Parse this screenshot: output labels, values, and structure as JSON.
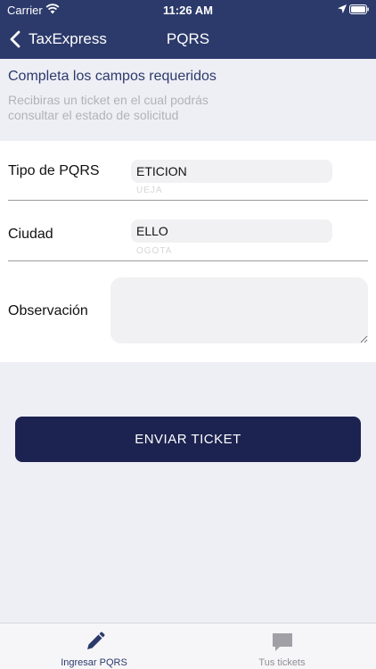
{
  "status_bar": {
    "carrier": "Carrier",
    "time": "11:26 AM"
  },
  "nav": {
    "back_label": "TaxExpress",
    "title": "PQRS"
  },
  "intro": {
    "title": "Completa los campos requeridos",
    "subtitle": "Recibiras un ticket en el cual podrás consultar el estado de solicitud"
  },
  "form": {
    "tipo": {
      "label": "Tipo de PQRS",
      "value": "ETICION",
      "ghost": "UEJA"
    },
    "ciudad": {
      "label": "Ciudad",
      "value": "ELLO",
      "ghost": "OGOTA"
    },
    "observacion": {
      "label": "Observación",
      "value": ""
    }
  },
  "submit_label": "ENVIAR TICKET",
  "tabs": [
    {
      "label": "Ingresar PQRS",
      "icon": "pencil-icon",
      "active": true
    },
    {
      "label": "Tus tickets",
      "icon": "chat-bubble-icon",
      "active": false
    }
  ],
  "colors": {
    "header": "#2c3a6b",
    "button": "#1c2350",
    "active_tab": "#2c3a6b",
    "inactive_tab": "#8e8e93"
  }
}
